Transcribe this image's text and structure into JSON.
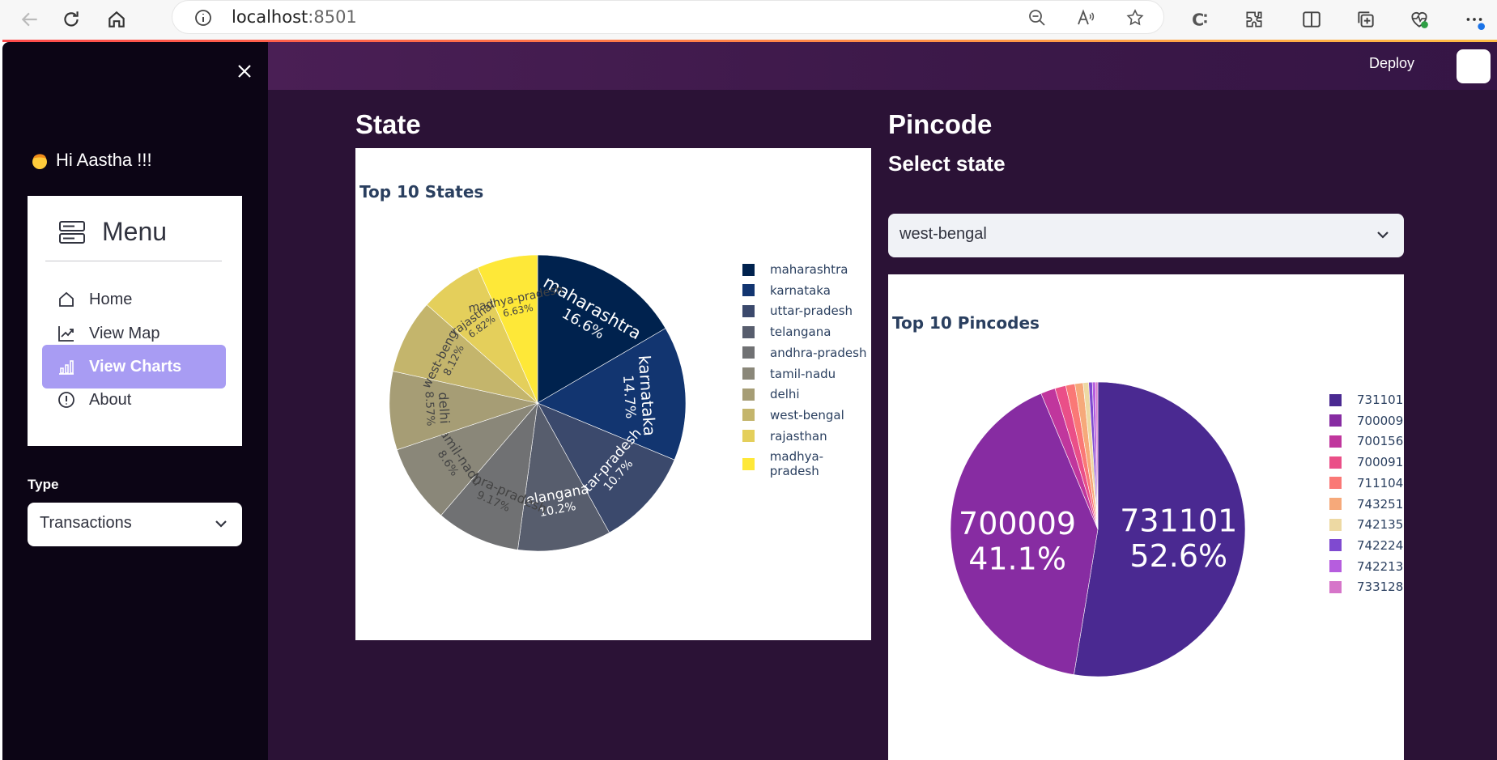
{
  "browser": {
    "url_host": "localhost",
    "url_port": ":8501"
  },
  "sidebar": {
    "greeting": "Hi Aastha !!!",
    "menu_title": "Menu",
    "menu_items": [
      {
        "label": "Home",
        "icon": "house-icon",
        "active": false
      },
      {
        "label": "View Map",
        "icon": "graph-up-icon",
        "active": false
      },
      {
        "label": "View Charts",
        "icon": "bar-chart-icon",
        "active": true
      },
      {
        "label": "About",
        "icon": "exclamation-circle-icon",
        "active": false
      }
    ],
    "type_label": "Type",
    "type_value": "Transactions"
  },
  "header": {
    "deploy_label": "Deploy"
  },
  "state_section": {
    "title": "State"
  },
  "pincode_section": {
    "title": "Pincode",
    "select_label": "Select state",
    "select_value": "west-bengal"
  },
  "chart_data": [
    {
      "type": "pie",
      "title": "Top 10 States",
      "labels": [
        "maharashtra",
        "karnataka",
        "uttar-pradesh",
        "telangana",
        "andhra-pradesh",
        "tamil-nadu",
        "delhi",
        "west-bengal",
        "rajasthan",
        "madhya-pradesh"
      ],
      "values": [
        16.6,
        14.7,
        10.7,
        10.2,
        9.17,
        8.6,
        8.57,
        8.12,
        6.82,
        6.63
      ],
      "value_labels": [
        "16.6%",
        "14.7%",
        "10.7%",
        "10.2%",
        "9.17%",
        "8.6%",
        "8.57%",
        "8.12%",
        "6.82%",
        "6.63%"
      ],
      "colors": [
        "#00224e",
        "#123570",
        "#3b496c",
        "#575d6d",
        "#707173",
        "#8a8779",
        "#a69d75",
        "#c4b56c",
        "#e4cf5b",
        "#fee838"
      ],
      "legend": "right"
    },
    {
      "type": "pie",
      "title": "Top 10 Pincodes",
      "labels": [
        "731101",
        "700009",
        "700156",
        "700091",
        "711104",
        "743251",
        "742135",
        "742224",
        "742213",
        "733128"
      ],
      "values": [
        52.6,
        41.1,
        1.6,
        1.2,
        1.0,
        0.9,
        0.6,
        0.4,
        0.35,
        0.25
      ],
      "value_labels": [
        "52.6%",
        "41.1%"
      ],
      "colors": [
        "#4a2991",
        "#872ca2",
        "#c0369d",
        "#ea4f88",
        "#fa7876",
        "#f6a97a",
        "#edd9a3",
        "#7f4ad0",
        "#b65dde",
        "#d675c9"
      ],
      "legend": "right"
    }
  ]
}
